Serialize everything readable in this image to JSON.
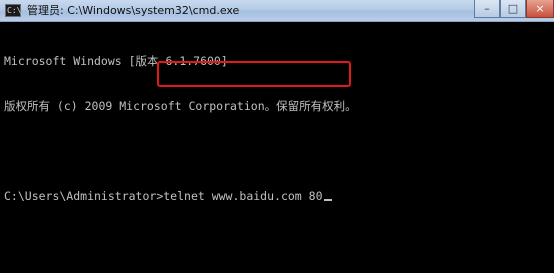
{
  "window": {
    "title": "管理员: C:\\Windows\\system32\\cmd.exe",
    "icon": "cmd-icon",
    "controls": {
      "minimize": "–",
      "maximize": "□",
      "close": "×"
    }
  },
  "console": {
    "lines": [
      "Microsoft Windows [版本 6.1.7600]",
      "版权所有 (c) 2009 Microsoft Corporation。保留所有权利。",
      "",
      "C:\\Users\\Administrator>telnet www.baidu.com 80"
    ],
    "prompt": "C:\\Users\\Administrator>",
    "command": "telnet www.baidu.com 80"
  },
  "annotation": {
    "color": "#e1191b"
  }
}
